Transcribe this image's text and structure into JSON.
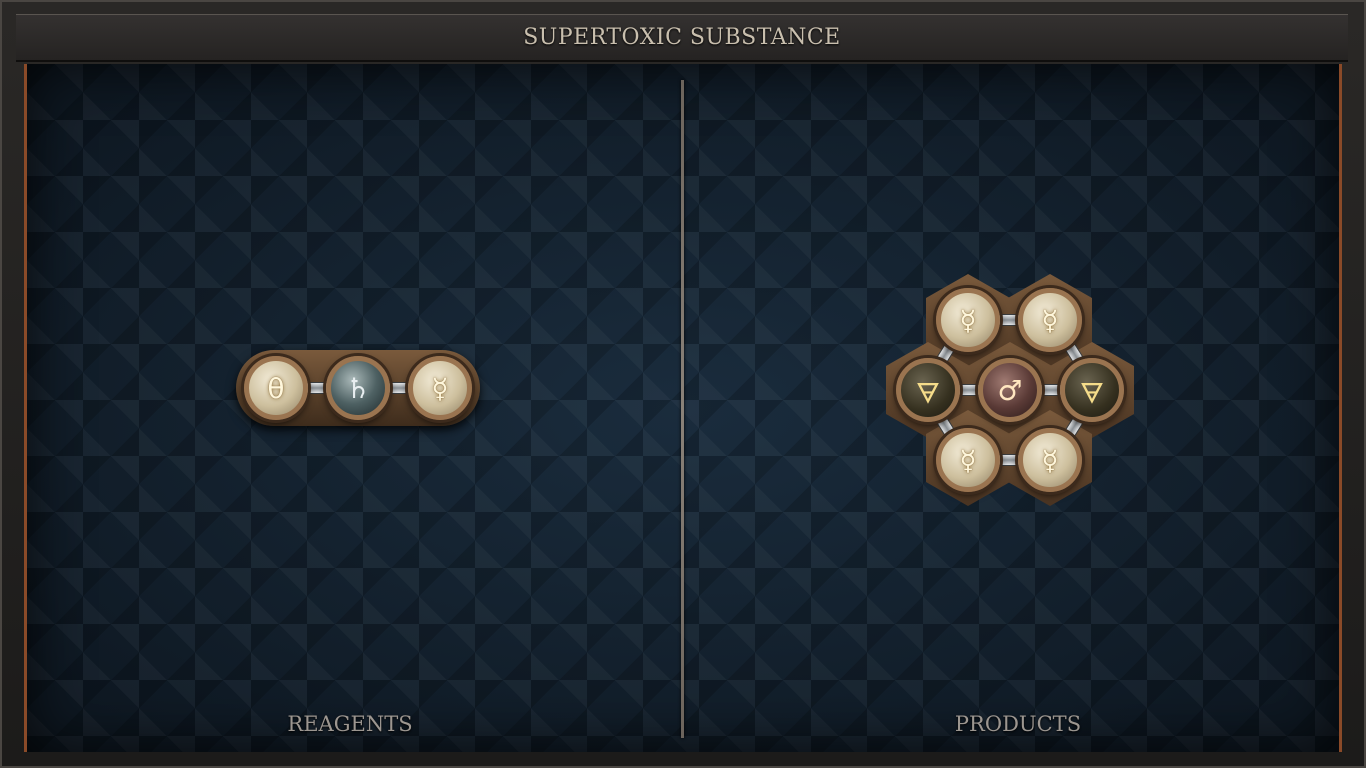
{
  "title": "SUPERTOXIC SUBSTANCE",
  "reagents_label": "REAGENTS",
  "products_label": "PRODUCTS",
  "reagents": {
    "atoms": [
      {
        "symbol": "θ",
        "element": "salt",
        "style": "light"
      },
      {
        "symbol": "♄",
        "element": "lead",
        "style": "dark-teal"
      },
      {
        "symbol": "☿",
        "element": "quicksilver",
        "style": "light"
      }
    ]
  },
  "products": {
    "atoms": [
      {
        "symbol": "☿",
        "element": "quicksilver",
        "style": "light"
      },
      {
        "symbol": "☿",
        "element": "quicksilver",
        "style": "light"
      },
      {
        "symbol": "🜃",
        "element": "earth",
        "style": "dark-olive"
      },
      {
        "symbol": "♂",
        "element": "iron",
        "style": "dark-rose"
      },
      {
        "symbol": "🜃",
        "element": "earth",
        "style": "dark-olive"
      },
      {
        "symbol": "☿",
        "element": "quicksilver",
        "style": "light"
      },
      {
        "symbol": "☿",
        "element": "quicksilver",
        "style": "light"
      }
    ]
  },
  "colors": {
    "board": "#132130",
    "frame_accent": "#8a4a28",
    "atom_rim": "#9a7450"
  }
}
